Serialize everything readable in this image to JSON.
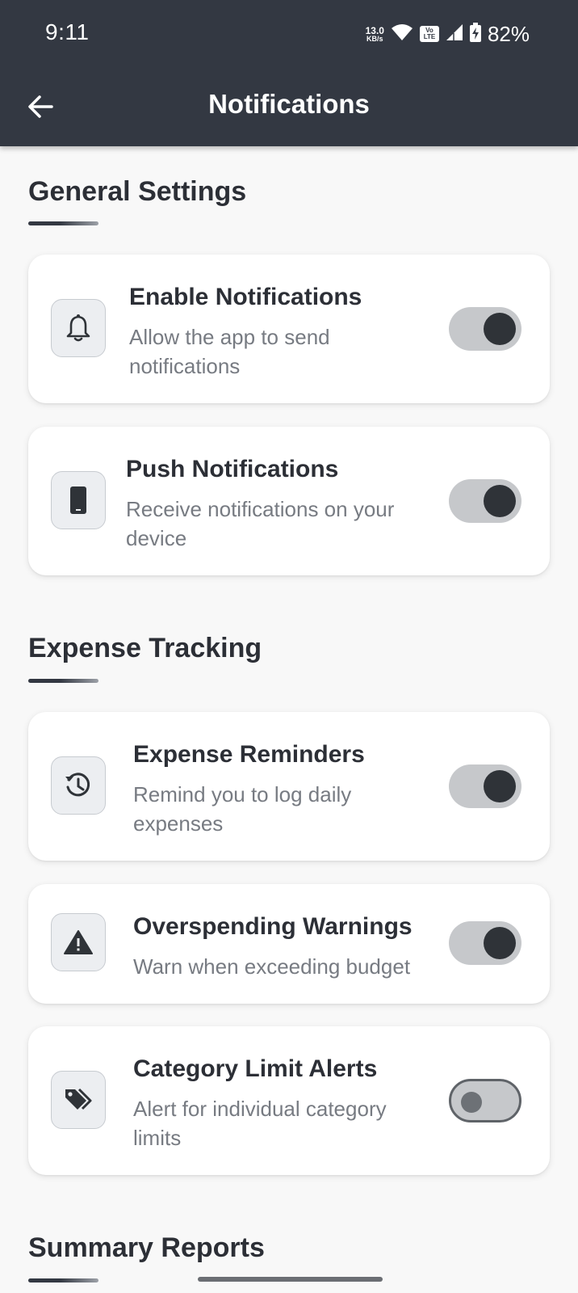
{
  "status_bar": {
    "time": "9:11",
    "net_speed_value": "13.0",
    "net_speed_unit": "KB/s",
    "volte": "Vo LTE",
    "battery_percent": "82%"
  },
  "header": {
    "title": "Notifications",
    "back_icon": "arrow-left-icon"
  },
  "sections": [
    {
      "title": "General Settings",
      "items": [
        {
          "title": "Enable Notifications",
          "desc": "Allow the app to send notifications",
          "icon": "bell-icon",
          "enabled": true
        },
        {
          "title": "Push Notifications",
          "desc": "Receive notifications on your device",
          "icon": "phone-icon",
          "enabled": true
        }
      ]
    },
    {
      "title": "Expense Tracking",
      "items": [
        {
          "title": "Expense Reminders",
          "desc": "Remind you to log daily expenses",
          "icon": "history-icon",
          "enabled": true
        },
        {
          "title": "Overspending Warnings",
          "desc": "Warn when exceeding budget",
          "icon": "warning-icon",
          "enabled": true
        },
        {
          "title": "Category Limit Alerts",
          "desc": "Alert for individual category limits",
          "icon": "tag-icon",
          "enabled": false
        }
      ]
    },
    {
      "title": "Summary Reports",
      "items": []
    }
  ],
  "colors": {
    "header_bg": "#333842",
    "toggle_thumb": "#2f3338",
    "toggle_track": "#c6c8cb",
    "page_bg": "#f8f8f8"
  }
}
